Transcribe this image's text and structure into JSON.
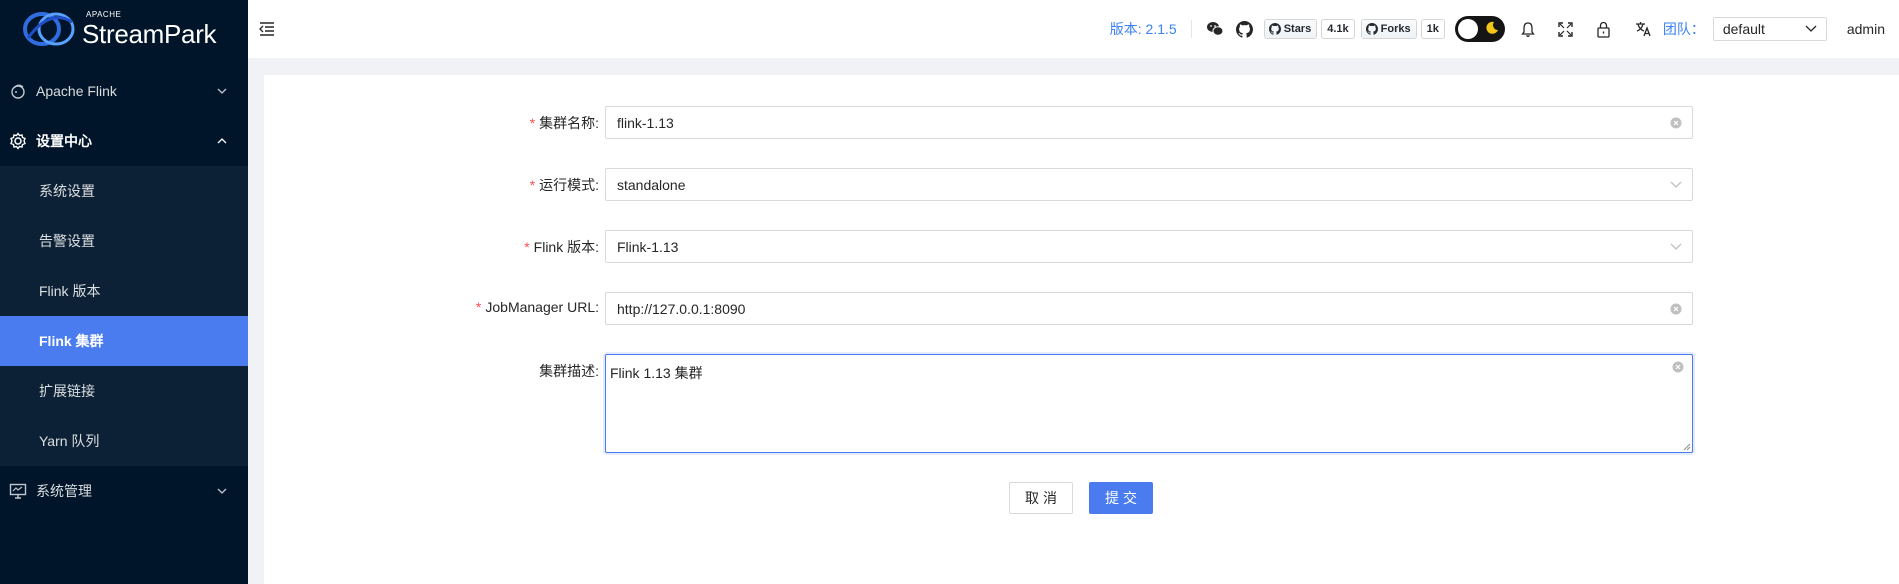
{
  "brand": {
    "apache": "APACHE",
    "name": "StreamPark"
  },
  "sidebar": {
    "items": [
      {
        "label": "Apache Flink"
      },
      {
        "label": "设置中心"
      },
      {
        "label": "系统管理"
      }
    ],
    "settings_sub": [
      {
        "label": "系统设置"
      },
      {
        "label": "告警设置"
      },
      {
        "label": "Flink 版本"
      },
      {
        "label": "Flink 集群"
      },
      {
        "label": "扩展链接"
      },
      {
        "label": "Yarn 队列"
      }
    ]
  },
  "header": {
    "version": "版本: 2.1.5",
    "stars_label": "Stars",
    "stars_count": "4.1k",
    "forks_label": "Forks",
    "forks_count": "1k",
    "team_label": "团队：",
    "team_value": "default",
    "user": "admin"
  },
  "form": {
    "cluster_name_label": "集群名称",
    "cluster_name_value": "flink-1.13",
    "run_mode_label": "运行模式",
    "run_mode_value": "standalone",
    "flink_version_label": "Flink 版本",
    "flink_version_value": "Flink-1.13",
    "jm_url_label": "JobManager URL",
    "jm_url_value": "http://127.0.0.1:8090",
    "desc_label": "集群描述",
    "desc_value": "Flink 1.13 集群",
    "cancel": "取消",
    "submit": "提交",
    "colon": ":"
  },
  "colors": {
    "accent": "#4a7cf0",
    "sidebar_bg": "#001529",
    "required": "#ff4d4f",
    "link": "#3b82f6"
  }
}
